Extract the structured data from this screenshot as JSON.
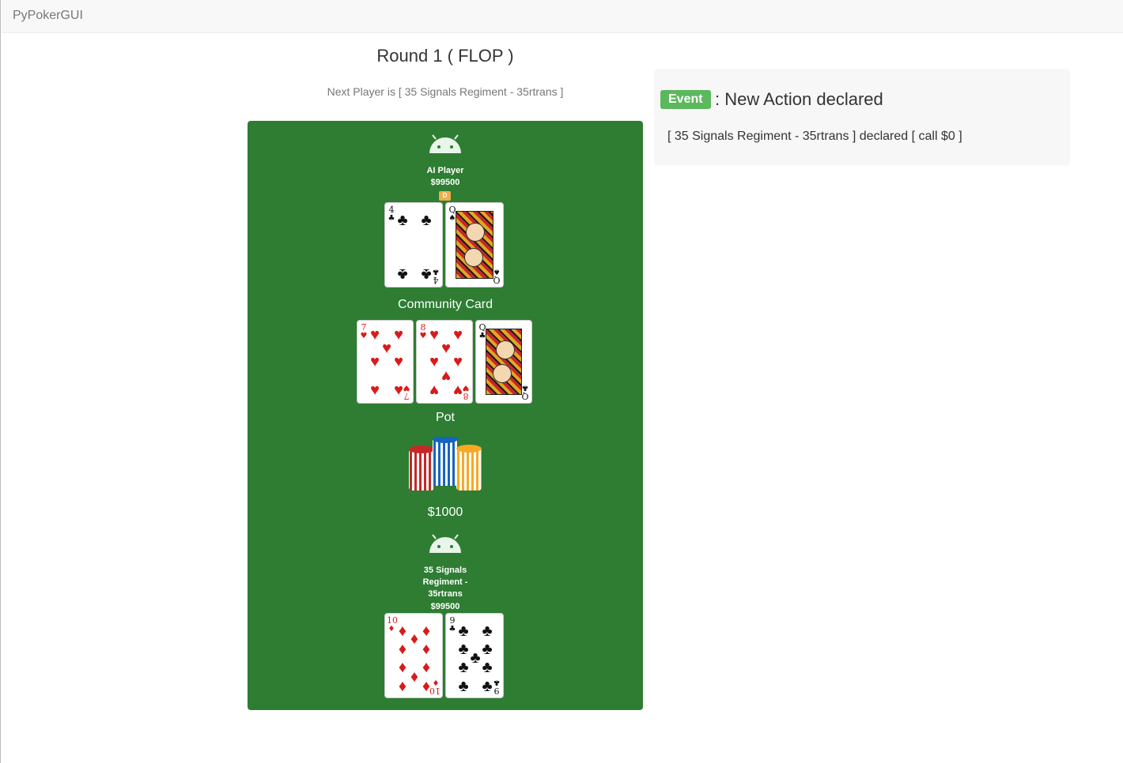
{
  "app": {
    "brand": "PyPokerGUI"
  },
  "header": {
    "round_title": "Round 1 ( FLOP )",
    "next_player": "Next Player is [ 35 Signals Regiment - 35rtrans ]"
  },
  "table": {
    "top_player": {
      "name": "AI Player",
      "stack": "$99500",
      "dealer_badge": "D",
      "icon": "android-icon",
      "cards": [
        {
          "rank": "4",
          "suit": "♣",
          "color": "black"
        },
        {
          "rank": "Q",
          "suit": "♠",
          "color": "black",
          "face": true
        }
      ]
    },
    "community_label": "Community Card",
    "community_cards": [
      {
        "rank": "7",
        "suit": "♥",
        "color": "red"
      },
      {
        "rank": "8",
        "suit": "♥",
        "color": "red"
      },
      {
        "rank": "Q",
        "suit": "♣",
        "color": "black",
        "face": true
      }
    ],
    "pot_label": "Pot",
    "pot_amount": "$1000",
    "chip_colors": [
      "#c62828",
      "#1565c0",
      "#f9a825"
    ],
    "bottom_player": {
      "name_line1": "35 Signals",
      "name_line2": "Regiment -",
      "name_line3": "35rtrans",
      "stack": "$99500",
      "icon": "android-icon",
      "cards": [
        {
          "rank": "10",
          "suit": "♦",
          "color": "red"
        },
        {
          "rank": "9",
          "suit": "♣",
          "color": "black"
        }
      ]
    }
  },
  "event": {
    "badge": "Event",
    "title": ": New Action declared",
    "message": "[ 35 Signals Regiment - 35rtrans ] declared [ call $0 ]"
  },
  "colors": {
    "table_green": "#2e7d32",
    "event_badge_green": "#5cb85c",
    "dealer_orange": "#f0ad4e"
  }
}
